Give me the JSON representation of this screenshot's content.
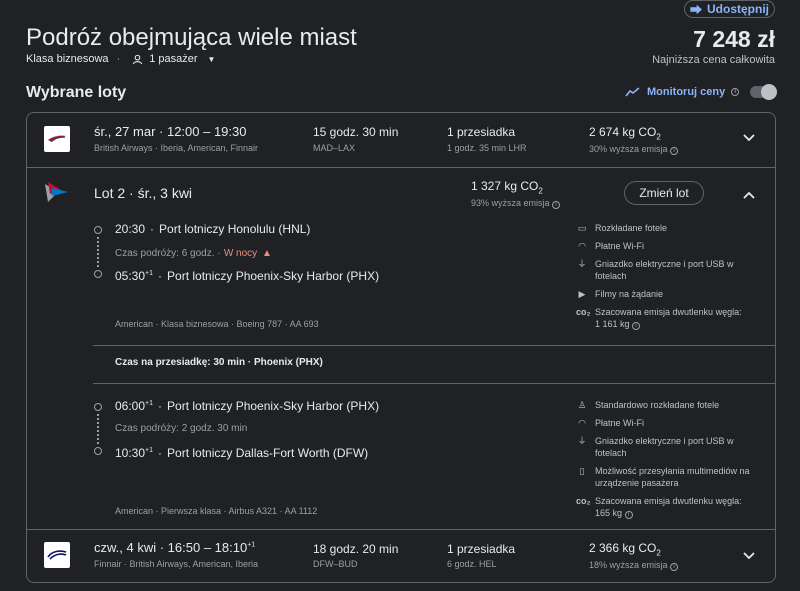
{
  "header": {
    "share_label": "Udostępnij",
    "title": "Podróż obejmująca wiele miast",
    "cabin": "Klasa biznesowa",
    "passengers": "1 pasażer",
    "price": "7 248 zł",
    "price_note": "Najniższa cena całkowita"
  },
  "section": {
    "title": "Wybrane loty",
    "monitor_label": "Monitoruj ceny"
  },
  "flight1": {
    "date_time": "śr., 27 mar · 12:00 – 19:30",
    "airlines": "British Airways · Iberia, American, Finnair",
    "duration": "15 godz. 30 min",
    "route": "MAD–LAX",
    "stops": "1 przesiadka",
    "layover": "1 godz. 35 min LHR",
    "emission": "2 674 kg CO",
    "emission_sub": "2",
    "emission_note": "30% wyższa emisja"
  },
  "flight2": {
    "title": "Lot 2 · śr., 3 kwi",
    "emission": "1 327 kg CO",
    "emission_sub": "2",
    "emission_note": "93% wyższa emisja",
    "change_label": "Zmień lot",
    "seg1": {
      "dep_time": "20:30",
      "dep_airport": "Port lotniczy Honolulu (HNL)",
      "travel_time": "Czas podróży: 6 godz.",
      "night_warning": "W nocy",
      "arr_time": "05:30",
      "arr_plus": "+1",
      "arr_airport": "Port lotniczy Phoenix-Sky Harbor (PHX)",
      "details": "American · Klasa biznesowa · Boeing 787 · AA 693",
      "amenities": [
        "Rozkładane fotele",
        "Płatne Wi-Fi",
        "Gniazdko elektryczne i port USB w fotelach",
        "Filmy na żądanie",
        "Szacowana emisja dwutlenku węgla:"
      ],
      "emission_value": "1 161 kg"
    },
    "layover": "Czas na przesiadkę: 30 min · Phoenix (PHX)",
    "seg2": {
      "dep_time": "06:00",
      "dep_plus": "+1",
      "dep_airport": "Port lotniczy Phoenix-Sky Harbor (PHX)",
      "travel_time": "Czas podróży: 2 godz. 30 min",
      "arr_time": "10:30",
      "arr_plus": "+1",
      "arr_airport": "Port lotniczy Dallas-Fort Worth (DFW)",
      "details": "American · Pierwsza klasa · Airbus A321 · AA 1112",
      "amenities": [
        "Standardowo rozkładane fotele",
        "Płatne Wi-Fi",
        "Gniazdko elektryczne i port USB w fotelach",
        "Możliwość przesyłania multimediów na urządzenie pasażera",
        "Szacowana emisja dwutlenku węgla:"
      ],
      "emission_value": "165 kg"
    }
  },
  "flight3": {
    "date_time": "czw., 4 kwi · 16:50 – 18:10",
    "plus": "+1",
    "airlines": "Finnair · British Airways, American, Iberia",
    "duration": "18 godz. 20 min",
    "route": "DFW–BUD",
    "stops": "1 przesiadka",
    "layover": "6 godz. HEL",
    "emission": "2 366 kg CO",
    "emission_sub": "2",
    "emission_note": "18% wyższa emisja"
  },
  "colors": {
    "background": "#202124",
    "accent": "#8ab4f8",
    "warning": "#f28b82",
    "border": "#5f6368"
  }
}
